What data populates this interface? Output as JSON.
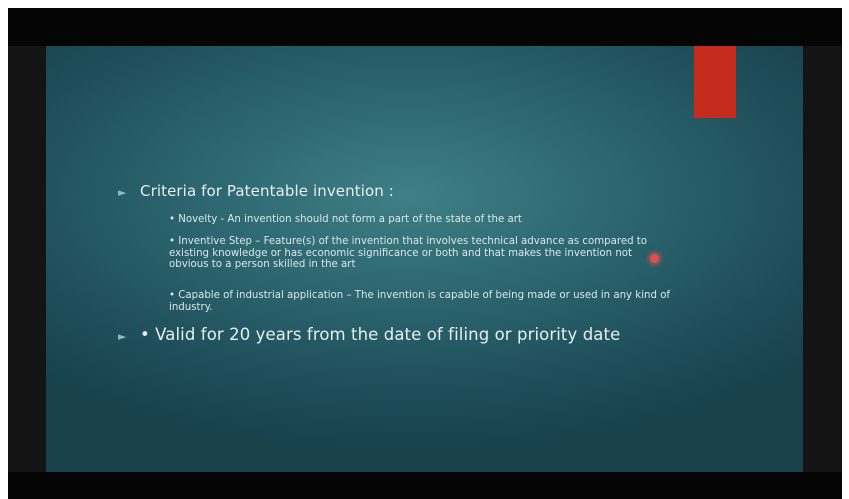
{
  "slide": {
    "heading_bullet": "Criteria for Patentable invention :",
    "sub_bullets": [
      "• Novelty - An invention should not form a part of the state of the art",
      "• Inventive Step – Feature(s) of the invention that involves technical advance as compared to existing knowledge or has economic significance or both and that makes the invention not obvious to a person skilled in the art",
      "• Capable of industrial application – The invention is capable of being made or used in any kind of industry."
    ],
    "second_bullet": "• Valid for 20 years from the date of filing or priority date",
    "bullet_marker": "►",
    "colors": {
      "background": "#2c6670",
      "accent_bar": "#c42b1c",
      "text": "#e8eef0",
      "pointer": "#e0504a"
    }
  }
}
